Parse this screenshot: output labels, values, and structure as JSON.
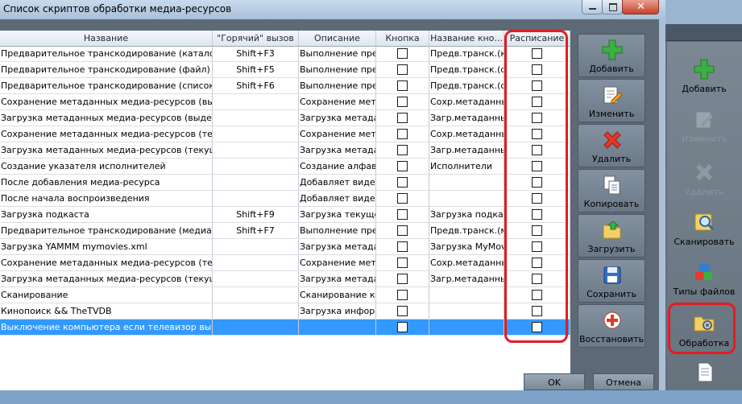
{
  "dialog": {
    "title": "Список скриптов обработки медиа-ресурсов",
    "ok_label": "OK",
    "cancel_label": "Отмена"
  },
  "table": {
    "columns": [
      "Название",
      "\"Горячий\" вызов",
      "Описание",
      "Кнопка",
      "Название кно...",
      "Расписание"
    ],
    "rows": [
      {
        "name": "Предварительное транскодирование (каталог)",
        "hotkey": "Shift+F3",
        "desc": "Выполнение пред",
        "button": false,
        "button_name": "Предв.транск.(к",
        "schedule": false
      },
      {
        "name": "Предварительное транскодирование (файл)",
        "hotkey": "Shift+F5",
        "desc": "Выполнение пред",
        "button": false,
        "button_name": "Предв.транск.(ф",
        "schedule": false
      },
      {
        "name": "Предварительное транскодирование (список)",
        "hotkey": "Shift+F6",
        "desc": "Выполнение пред",
        "button": false,
        "button_name": "Предв.транск.(с",
        "schedule": false
      },
      {
        "name": "Сохранение метаданных медиа-ресурсов (выделен",
        "hotkey": "",
        "desc": "Сохранение метад",
        "button": false,
        "button_name": "Сохр.метаданны",
        "schedule": false
      },
      {
        "name": "Загрузка метаданных медиа-ресурсов (выделенны",
        "hotkey": "",
        "desc": "Загрузка метадан",
        "button": false,
        "button_name": "Загр.метаданны:",
        "schedule": false
      },
      {
        "name": "Сохранение метаданных медиа-ресурсов (текущий",
        "hotkey": "",
        "desc": "Сохранение метад",
        "button": false,
        "button_name": "Сохр.метаданны",
        "schedule": false
      },
      {
        "name": "Загрузка метаданных медиа-ресурсов (текущий сп",
        "hotkey": "",
        "desc": "Загрузка метадан",
        "button": false,
        "button_name": "Загр.метаданны:",
        "schedule": false
      },
      {
        "name": "Создание указателя исполнителей",
        "hotkey": "",
        "desc": "Создание алфави",
        "button": false,
        "button_name": "Исполнители",
        "schedule": false
      },
      {
        "name": "После добавления медиа-ресурса",
        "hotkey": "",
        "desc": "Добавляет видео",
        "button": false,
        "button_name": "",
        "schedule": false
      },
      {
        "name": "После начала воспроизведения",
        "hotkey": "",
        "desc": "Добавляет видео",
        "button": false,
        "button_name": "",
        "schedule": false
      },
      {
        "name": "Загрузка подкаста",
        "hotkey": "Shift+F9",
        "desc": "Загрузка текущег",
        "button": false,
        "button_name": "Загрузка подкас",
        "schedule": false
      },
      {
        "name": "Предварительное транскодирование (медиа-ресур",
        "hotkey": "Shift+F7",
        "desc": "Выполнение пред",
        "button": false,
        "button_name": "Предв.транск.(м",
        "schedule": false
      },
      {
        "name": "Загрузка YAMMM mymovies.xml",
        "hotkey": "",
        "desc": "Загрузка метадан",
        "button": false,
        "button_name": "Загрузка MyMovi",
        "schedule": false
      },
      {
        "name": "Сохранение метаданных медиа-ресурсов (текущая",
        "hotkey": "",
        "desc": "Сохранение метад",
        "button": false,
        "button_name": "Сохр.метаданны",
        "schedule": false
      },
      {
        "name": "Загрузка метаданных медиа-ресурсов (текущая па",
        "hotkey": "",
        "desc": "Загрузка метадан",
        "button": false,
        "button_name": "Загр.метаданны:",
        "schedule": false
      },
      {
        "name": "Сканирование",
        "hotkey": "",
        "desc": "Сканирование ка",
        "button": false,
        "button_name": "",
        "schedule": false
      },
      {
        "name": "Кинопоиск && TheTVDB",
        "hotkey": "",
        "desc": "Загрузка информ",
        "button": false,
        "button_name": "",
        "schedule": false
      },
      {
        "name": "Выключение компьютера если телевизор выключе",
        "hotkey": "",
        "desc": "",
        "button": false,
        "button_name": "",
        "schedule": false,
        "selected": true
      }
    ]
  },
  "actions": [
    {
      "id": "add",
      "label": "Добавить",
      "icon": "plus-icon"
    },
    {
      "id": "edit",
      "label": "Изменить",
      "icon": "edit-icon"
    },
    {
      "id": "delete",
      "label": "Удалить",
      "icon": "delete-x-icon"
    },
    {
      "id": "copy",
      "label": "Копировать",
      "icon": "copy-icon"
    },
    {
      "id": "load",
      "label": "Загрузить",
      "icon": "folder-open-icon"
    },
    {
      "id": "save",
      "label": "Сохранить",
      "icon": "floppy-icon"
    },
    {
      "id": "restore",
      "label": "Восстановить",
      "icon": "restore-icon"
    }
  ],
  "side_panel": [
    {
      "label": "Добавить",
      "icon": "plus-icon",
      "disabled": false
    },
    {
      "label": "Изменить",
      "icon": "edit-icon",
      "disabled": true
    },
    {
      "label": "Удалить",
      "icon": "delete-x-icon",
      "disabled": true
    },
    {
      "label": "Сканировать",
      "icon": "scan-icon",
      "disabled": false
    },
    {
      "label": "Типы файлов",
      "icon": "file-types-icon",
      "disabled": false
    },
    {
      "label": "Обработка",
      "icon": "processing-icon",
      "disabled": false
    }
  ],
  "colors": {
    "highlight_ring": "#e41b23",
    "selection": "#3399ff",
    "plus_green": "#3cb043",
    "delete_red": "#e2382b"
  }
}
